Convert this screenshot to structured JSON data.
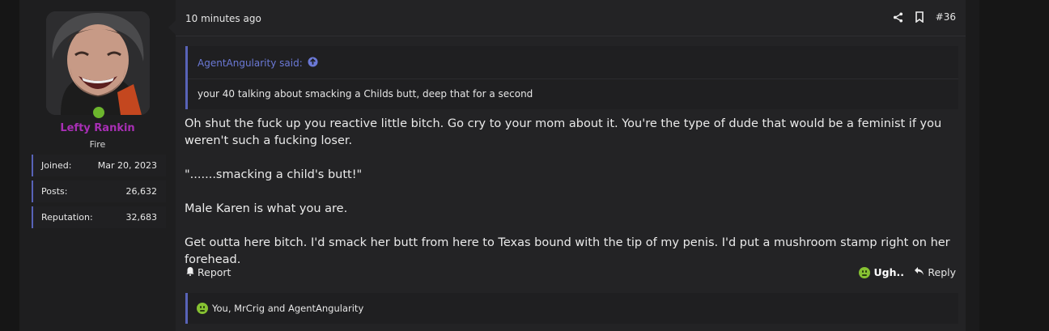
{
  "user": {
    "name": "Lefty Rankin",
    "title": "Fire",
    "stats": [
      {
        "label": "Joined:",
        "value": "Mar 20, 2023"
      },
      {
        "label": "Posts:",
        "value": "26,632"
      },
      {
        "label": "Reputation:",
        "value": "32,683"
      }
    ],
    "name_color": "#a82fb5",
    "online_color": "#6cb52d"
  },
  "post": {
    "time": "10 minutes ago",
    "number": "#36",
    "quote": {
      "author_line": "AgentAngularity said:",
      "text": "your 40 talking about smacking a Childs butt, deep that for a second"
    },
    "message": [
      "Oh shut the fuck up you reactive little bitch. Go cry to your mom about it. You're the type of dude that would be a feminist if you weren't such a fucking loser.",
      "\".......smacking a child's butt!\"",
      "Male Karen is what you are.",
      "Get outta here bitch. I'd smack her butt from here to Texas bound with the tip of my penis. I'd put a mushroom stamp right on her forehead."
    ],
    "actions": {
      "report": "Report",
      "reaction": "Ugh..",
      "reply": "Reply"
    },
    "reactions_summary": "You, MrCrig and AgentAngularity",
    "icons": {
      "share": "share-icon",
      "bookmark": "bookmark-icon",
      "quote_up": "arrow-up-circle-icon",
      "report": "bell-icon",
      "reaction": "ugh-emoji-icon",
      "reply": "reply-arrow-icon"
    },
    "accent_color": "#5863b8"
  }
}
